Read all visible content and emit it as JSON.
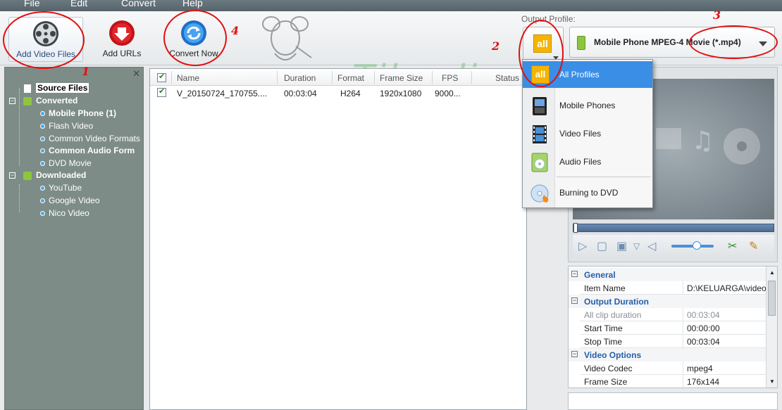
{
  "menu": [
    "File",
    "Edit",
    "Convert",
    "Help"
  ],
  "toolbar": {
    "add_video": "Add Video Files",
    "add_urls": "Add URLs",
    "convert_now": "Convert Now"
  },
  "output_profile": {
    "label": "Output Profile:",
    "badge": "all",
    "selected": "Mobile Phone MPEG-4 Movie (*.mp4)"
  },
  "annotations": [
    "1",
    "2",
    "3",
    "4"
  ],
  "watermark": "Tikuslia.com",
  "sidebar": {
    "items": [
      {
        "label": "Source Files"
      },
      {
        "label": "Converted"
      },
      {
        "label": "Mobile Phone (1)"
      },
      {
        "label": "Flash Video"
      },
      {
        "label": "Common Video Formats"
      },
      {
        "label": "Common Audio Form"
      },
      {
        "label": "DVD Movie"
      },
      {
        "label": "Downloaded"
      },
      {
        "label": "YouTube"
      },
      {
        "label": "Google Video"
      },
      {
        "label": "Nico Video"
      }
    ]
  },
  "table": {
    "columns": [
      "Name",
      "Duration",
      "Format",
      "Frame Size",
      "FPS",
      "Status"
    ],
    "rows": [
      {
        "name": "V_20150724_170755....",
        "duration": "00:03:04",
        "format": "H264",
        "frame_size": "1920x1080",
        "fps": "9000..."
      }
    ]
  },
  "dropdown": {
    "items": [
      {
        "label": "All Profiles",
        "icon": "all-profiles-icon"
      },
      {
        "label": "Mobile Phones",
        "icon": "mobile-phone-icon"
      },
      {
        "label": "Video Files",
        "icon": "video-file-icon"
      },
      {
        "label": "Audio Files",
        "icon": "audio-file-icon"
      },
      {
        "label": "Burning to DVD",
        "icon": "dvd-burn-icon"
      }
    ]
  },
  "properties": {
    "general": "General",
    "item_name_k": "Item Name",
    "item_name_v": "D:\\KELUARGA\\video...",
    "output_duration": "Output Duration",
    "all_clip_k": "All clip duration",
    "all_clip_v": "00:03:04",
    "start_k": "Start Time",
    "start_v": "00:00:00",
    "stop_k": "Stop Time",
    "stop_v": "00:03:04",
    "video_options": "Video Options",
    "codec_k": "Video Codec",
    "codec_v": "mpeg4",
    "frame_k": "Frame Size",
    "frame_v": "176x144"
  },
  "colors": {
    "accent": "#3a8ee6",
    "annotation": "#e01010",
    "sidebar_bg": "#7d8c86",
    "badge": "#f4b400"
  }
}
